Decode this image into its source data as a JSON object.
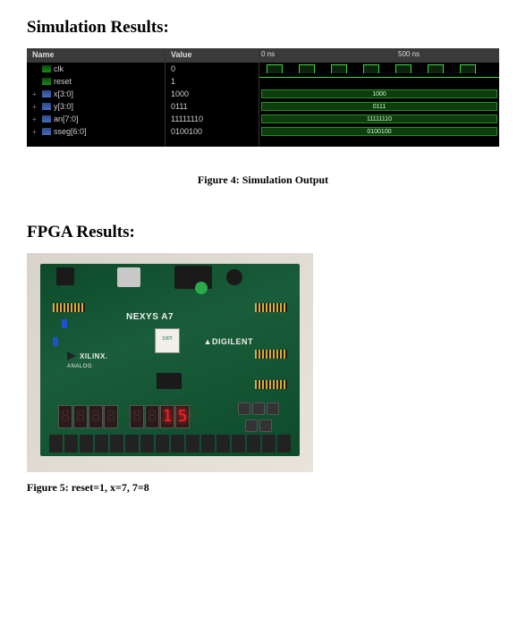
{
  "section1_heading": "Simulation Results:",
  "sim": {
    "header_name": "Name",
    "header_value": "Value",
    "timeline_start": "0 ns",
    "timeline_mark": "500 ns",
    "signals": [
      {
        "icon": "green",
        "exp": "",
        "name": "clk",
        "value": "0"
      },
      {
        "icon": "green",
        "exp": "",
        "name": "reset",
        "value": "1"
      },
      {
        "icon": "blue",
        "exp": "+",
        "name": "x[3:0]",
        "value": "1000",
        "bus": "1000"
      },
      {
        "icon": "blue",
        "exp": "+",
        "name": "y[3:0]",
        "value": "0111",
        "bus": "0111"
      },
      {
        "icon": "blue",
        "exp": "+",
        "name": "an[7:0]",
        "value": "11111110",
        "bus": "11111110"
      },
      {
        "icon": "blue",
        "exp": "+",
        "name": "sseg[6:0]",
        "value": "0100100",
        "bus": "0100100"
      }
    ]
  },
  "figure4_caption": "Figure 4: Simulation Output",
  "section2_heading": "FPGA Results:",
  "board": {
    "name_label": "NEXYS A7",
    "xilinx_label": "XILINX.",
    "digilent_label": "DIGILENT",
    "analog_label": "ANALOG",
    "chip_label": "100T",
    "sseg_digits": [
      "8",
      "8",
      "8",
      "8",
      "8",
      "8",
      "1",
      "5"
    ],
    "lit_index_start": 6
  },
  "figure5_caption": "Figure 5: reset=1, x=7, 7=8"
}
